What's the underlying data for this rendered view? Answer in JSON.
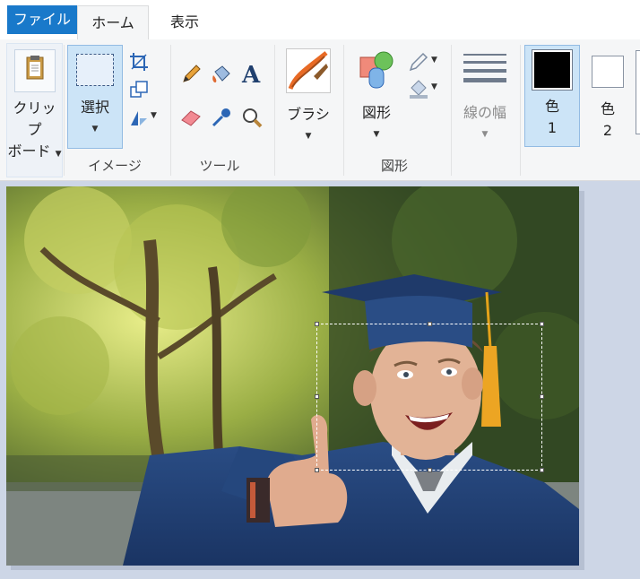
{
  "tabs": {
    "file": "ファイル",
    "home": "ホーム",
    "view": "表示"
  },
  "clipboard": {
    "label_line1": "クリップ",
    "label_line2": "ボード"
  },
  "image_group": {
    "select_label": "選択",
    "group_label": "イメージ"
  },
  "tools_group": {
    "group_label": "ツール"
  },
  "brush": {
    "label": "ブラシ"
  },
  "shapes_group": {
    "shapes_label": "図形",
    "group_label": "図形"
  },
  "size": {
    "label": "線の幅"
  },
  "color1": {
    "label_line1": "色",
    "label_line2": "1"
  },
  "color2": {
    "label_line1": "色",
    "label_line2": "2"
  },
  "colors": {
    "accent": "#1979ca",
    "color1": "#000000",
    "color2": "#ffffff",
    "ribbon_bg": "#f5f6f7",
    "canvas_bg": "#cdd6e6"
  },
  "image": {
    "subject": "graduate in cap and gown giving thumbs up"
  }
}
